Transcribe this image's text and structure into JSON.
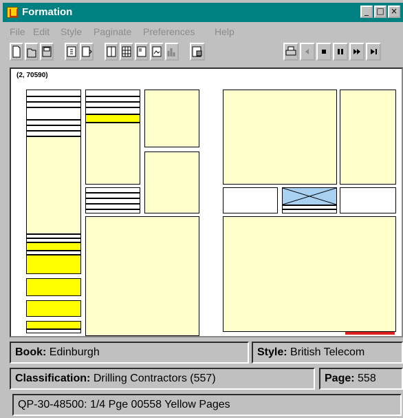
{
  "window": {
    "title": "Formation"
  },
  "menu": [
    "File",
    "Edit",
    "Style",
    "Paginate",
    "Preferences",
    "Help"
  ],
  "canvas": {
    "coords": "(2, 70590)"
  },
  "status": {
    "book_label": "Book:",
    "book_value": "Edinburgh",
    "style_label": "Style:",
    "style_value": "British Telecom",
    "classification_label": "Classification:",
    "classification_value": "Drilling Contractors (557)",
    "page_label": "Page:",
    "page_value": "558",
    "footer": "QP-30-48500: 1/4 Pge 00558 Yellow Pages"
  },
  "colors": {
    "titlebar": "#008080",
    "panel": "#ffffcc",
    "highlight": "#ffff00",
    "image": "#a8d0f0",
    "marker": "#e02020"
  }
}
